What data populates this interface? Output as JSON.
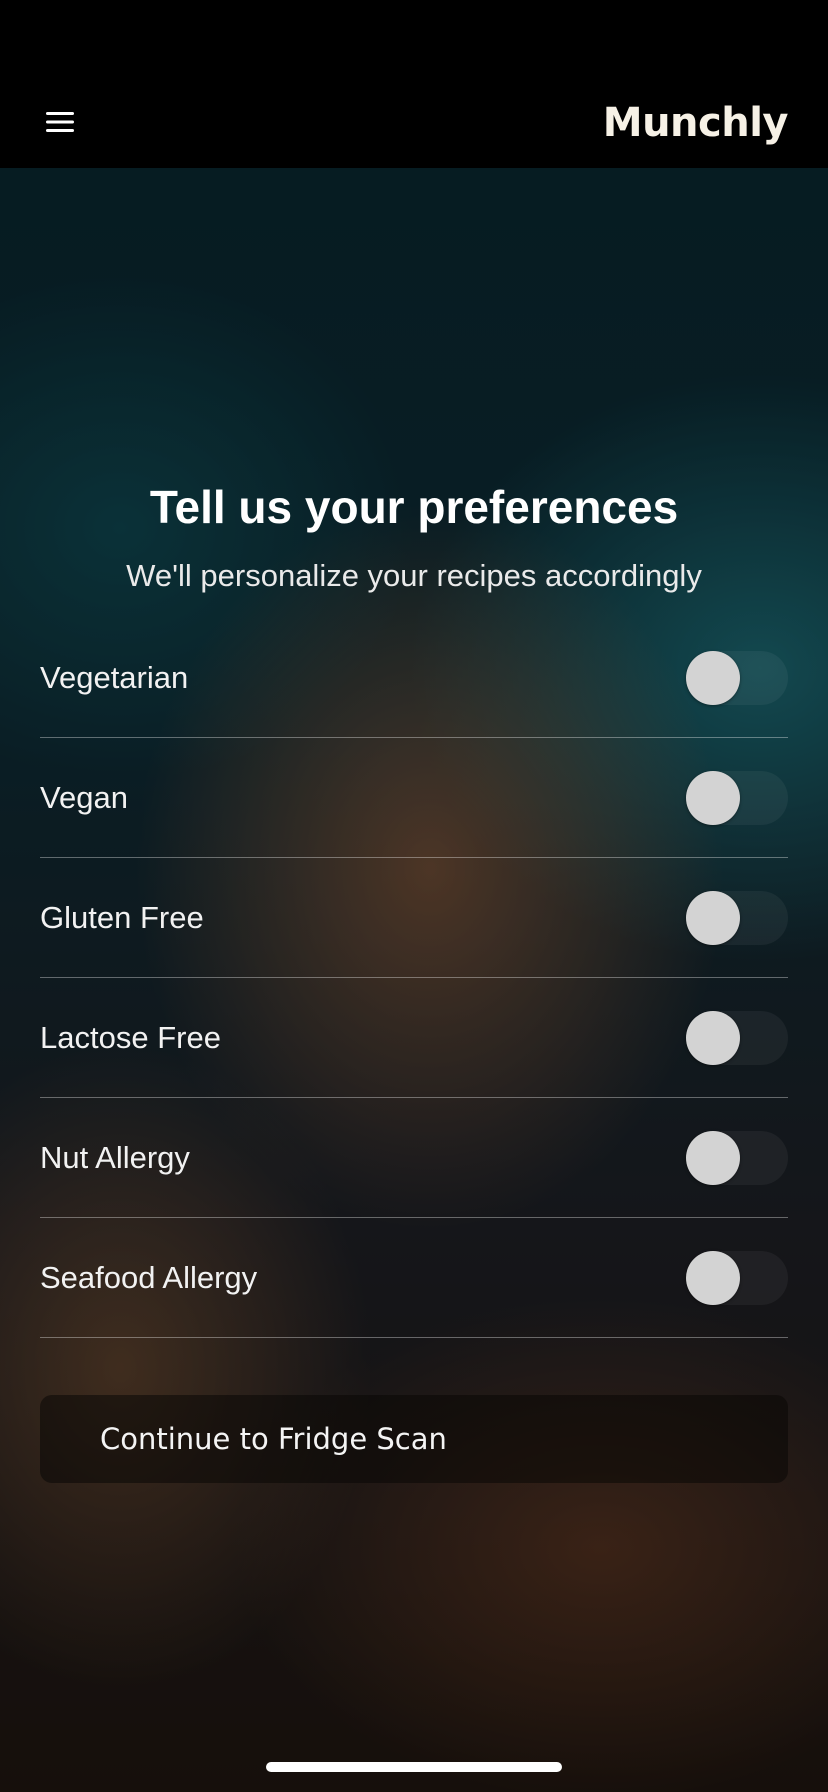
{
  "header": {
    "menu_icon": "hamburger-menu-icon",
    "brand": "Munchly"
  },
  "main": {
    "title": "Tell us your preferences",
    "subtitle": "We'll personalize your recipes accordingly",
    "preferences": [
      {
        "label": "Vegetarian",
        "enabled": false
      },
      {
        "label": "Vegan",
        "enabled": false
      },
      {
        "label": "Gluten Free",
        "enabled": false
      },
      {
        "label": "Lactose Free",
        "enabled": false
      },
      {
        "label": "Nut Allergy",
        "enabled": false
      },
      {
        "label": "Seafood Allergy",
        "enabled": false
      }
    ],
    "cta_label": "Continue to Fridge Scan"
  },
  "colors": {
    "background": "#000000",
    "text": "#ffffff",
    "brand": "#f6f1e6",
    "toggle_knob": "#d3d3d3"
  }
}
